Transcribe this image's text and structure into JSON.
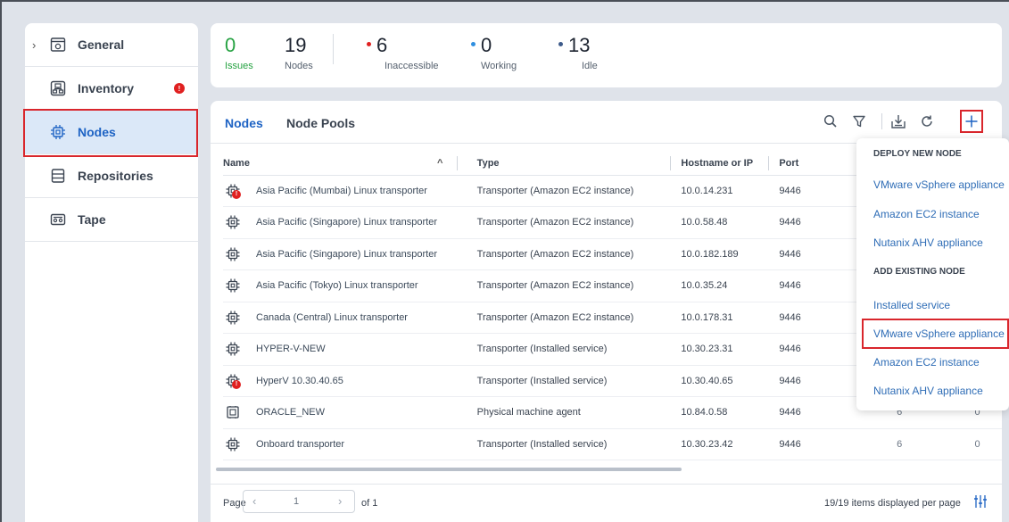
{
  "sidebar": {
    "items": [
      {
        "label": "General",
        "icon": "general-icon",
        "expand": "chevron-right-icon"
      },
      {
        "label": "Inventory",
        "icon": "inventory-icon",
        "badge": "!"
      },
      {
        "label": "Nodes",
        "icon": "node-chip-icon",
        "active": true
      },
      {
        "label": "Repositories",
        "icon": "repository-icon"
      },
      {
        "label": "Tape",
        "icon": "tape-icon"
      }
    ]
  },
  "stats": {
    "issues": {
      "value": "0",
      "label": "Issues",
      "color": "#26a242"
    },
    "nodes": {
      "value": "19",
      "label": "Nodes"
    },
    "inaccessible": {
      "value": "6",
      "label": "Inaccessible",
      "dot_color": "#e02020"
    },
    "working": {
      "value": "0",
      "label": "Working",
      "dot_color": "#2f8fe0"
    },
    "idle": {
      "value": "13",
      "label": "Idle",
      "dot_color": "#3d5a8a"
    }
  },
  "tabs": [
    "Nodes",
    "Node Pools"
  ],
  "toolbar": {
    "icons": [
      "search-icon",
      "filter-icon",
      "export-icon",
      "refresh-icon",
      "add-icon"
    ]
  },
  "table": {
    "columns": [
      "Name",
      "Type",
      "Hostname or IP",
      "Port"
    ],
    "sort_indicator": "^",
    "rows": [
      {
        "name": "Asia Pacific (Mumbai) Linux transporter",
        "type": "Transporter (Amazon EC2 instance)",
        "host": "10.0.14.231",
        "port": "9446",
        "error": true
      },
      {
        "name": "Asia Pacific (Singapore) Linux transporter",
        "type": "Transporter (Amazon EC2 instance)",
        "host": "10.0.58.48",
        "port": "9446"
      },
      {
        "name": "Asia Pacific (Singapore) Linux transporter",
        "type": "Transporter (Amazon EC2 instance)",
        "host": "10.0.182.189",
        "port": "9446"
      },
      {
        "name": "Asia Pacific (Tokyo) Linux transporter",
        "type": "Transporter (Amazon EC2 instance)",
        "host": "10.0.35.24",
        "port": "9446"
      },
      {
        "name": "Canada (Central) Linux transporter",
        "type": "Transporter (Amazon EC2 instance)",
        "host": "10.0.178.31",
        "port": "9446"
      },
      {
        "name": "HYPER-V-NEW",
        "type": "Transporter (Installed service)",
        "host": "10.30.23.31",
        "port": "9446"
      },
      {
        "name": "HyperV 10.30.40.65",
        "type": "Transporter (Installed service)",
        "host": "10.30.40.65",
        "port": "9446",
        "error": true
      },
      {
        "name": "ORACLE_NEW",
        "type": "Physical machine agent",
        "host": "10.84.0.58",
        "port": "9446",
        "extra1": "6",
        "extra2": "0",
        "agent": true
      },
      {
        "name": "Onboard transporter",
        "type": "Transporter (Installed service)",
        "host": "10.30.23.42",
        "port": "9446",
        "extra1": "6",
        "extra2": "0"
      }
    ]
  },
  "footer": {
    "page_label": "Page",
    "page_current": "1",
    "page_of": "of 1",
    "items_text": "19/19 items displayed per page"
  },
  "dropdown": {
    "deploy_header": "DEPLOY NEW NODE",
    "deploy_items": [
      "VMware vSphere appliance",
      "Amazon EC2 instance",
      "Nutanix AHV appliance"
    ],
    "existing_header": "ADD EXISTING NODE",
    "existing_items": [
      "Installed service",
      "VMware vSphere appliance",
      "Amazon EC2 instance",
      "Nutanix AHV appliance"
    ]
  },
  "colors": {
    "accent": "#1e63c4",
    "highlight": "#d9262c",
    "error": "#e02020"
  }
}
